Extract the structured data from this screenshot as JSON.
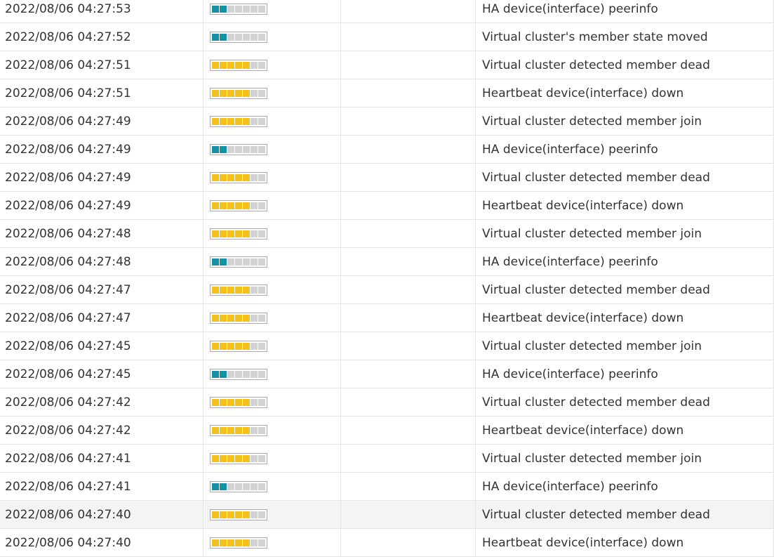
{
  "colors": {
    "info": "#1591a6",
    "warning": "#f2c11e",
    "empty": "#d2d2d2"
  },
  "level_scale_max": 7,
  "rows": [
    {
      "date": "2022/08/06 04:27:53",
      "level": "info",
      "level_segments": 2,
      "message": "HA device(interface) peerinfo"
    },
    {
      "date": "2022/08/06 04:27:52",
      "level": "info",
      "level_segments": 2,
      "message": "Virtual cluster's member state moved"
    },
    {
      "date": "2022/08/06 04:27:51",
      "level": "warning",
      "level_segments": 5,
      "message": "Virtual cluster detected member dead"
    },
    {
      "date": "2022/08/06 04:27:51",
      "level": "warning",
      "level_segments": 5,
      "message": "Heartbeat device(interface) down"
    },
    {
      "date": "2022/08/06 04:27:49",
      "level": "warning",
      "level_segments": 5,
      "message": "Virtual cluster detected member join"
    },
    {
      "date": "2022/08/06 04:27:49",
      "level": "info",
      "level_segments": 2,
      "message": "HA device(interface) peerinfo"
    },
    {
      "date": "2022/08/06 04:27:49",
      "level": "warning",
      "level_segments": 5,
      "message": "Virtual cluster detected member dead"
    },
    {
      "date": "2022/08/06 04:27:49",
      "level": "warning",
      "level_segments": 5,
      "message": "Heartbeat device(interface) down"
    },
    {
      "date": "2022/08/06 04:27:48",
      "level": "warning",
      "level_segments": 5,
      "message": "Virtual cluster detected member join"
    },
    {
      "date": "2022/08/06 04:27:48",
      "level": "info",
      "level_segments": 2,
      "message": "HA device(interface) peerinfo"
    },
    {
      "date": "2022/08/06 04:27:47",
      "level": "warning",
      "level_segments": 5,
      "message": "Virtual cluster detected member dead"
    },
    {
      "date": "2022/08/06 04:27:47",
      "level": "warning",
      "level_segments": 5,
      "message": "Heartbeat device(interface) down"
    },
    {
      "date": "2022/08/06 04:27:45",
      "level": "warning",
      "level_segments": 5,
      "message": "Virtual cluster detected member join"
    },
    {
      "date": "2022/08/06 04:27:45",
      "level": "info",
      "level_segments": 2,
      "message": "HA device(interface) peerinfo"
    },
    {
      "date": "2022/08/06 04:27:42",
      "level": "warning",
      "level_segments": 5,
      "message": "Virtual cluster detected member dead"
    },
    {
      "date": "2022/08/06 04:27:42",
      "level": "warning",
      "level_segments": 5,
      "message": "Heartbeat device(interface) down"
    },
    {
      "date": "2022/08/06 04:27:41",
      "level": "warning",
      "level_segments": 5,
      "message": "Virtual cluster detected member join"
    },
    {
      "date": "2022/08/06 04:27:41",
      "level": "info",
      "level_segments": 2,
      "message": "HA device(interface) peerinfo"
    },
    {
      "date": "2022/08/06 04:27:40",
      "level": "warning",
      "level_segments": 5,
      "message": "Virtual cluster detected member dead",
      "highlighted": true
    },
    {
      "date": "2022/08/06 04:27:40",
      "level": "warning",
      "level_segments": 5,
      "message": "Heartbeat device(interface) down"
    }
  ]
}
